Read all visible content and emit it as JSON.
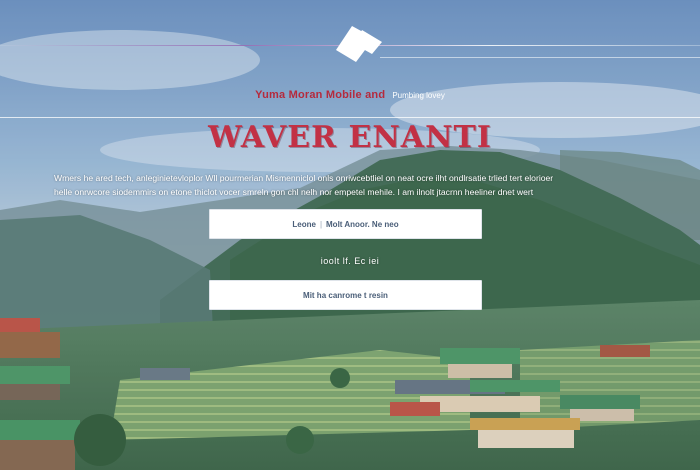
{
  "brand": {
    "name": "Yuma Moran Mobile and",
    "tagline": "Pumbing lovey"
  },
  "headline": "WAVER ENANTI",
  "description": [
    "Wmers he ared tech, anleginietevloplor Wll pourmerian Mismenniclol onls onriwcebtliel on neat ocre ilht ondlrsatie trlied tert elorioer",
    "helle onrwcore siodemmirs on etone thiclot vocer smreln gon chl nelh nor empetel mehile. I am ilnolt jtacrnn heeliner dnet wert"
  ],
  "buttons": {
    "primary_left": "Leone",
    "primary_sep": "|",
    "primary_right": "Molt Anoor. Ne neo",
    "secondary": "Mit ha canrome t resin"
  },
  "or_text": "ioolt lf. Ec iei",
  "colors": {
    "accent": "#c23145",
    "brand": "#b52a3d",
    "button_text": "#4a5e78"
  },
  "icons": {
    "logo": "diamond-logo-icon"
  }
}
